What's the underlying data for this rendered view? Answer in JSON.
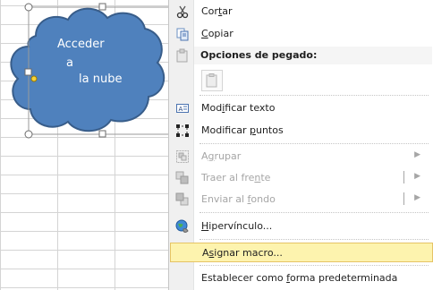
{
  "shape": {
    "line1": "Acceder",
    "line2": "a",
    "line3": "la nube"
  },
  "menu": {
    "cortar": {
      "pre": "Cor",
      "key": "t",
      "post": "ar"
    },
    "copiar": {
      "pre": "",
      "key": "C",
      "post": "opiar"
    },
    "paste_header": "Opciones de pegado:",
    "modificar_texto": {
      "pre": "Mod",
      "key": "i",
      "post": "ficar texto"
    },
    "modificar_puntos": {
      "pre": "Modificar ",
      "key": "p",
      "post": "untos"
    },
    "agrupar": {
      "pre": "A",
      "key": "g",
      "post": "rupar"
    },
    "traer": {
      "pre": "Traer al fre",
      "key": "n",
      "post": "te"
    },
    "enviar": {
      "pre": "Enviar al ",
      "key": "f",
      "post": "ondo"
    },
    "hipervinculo": {
      "pre": "",
      "key": "H",
      "post": "ipervínculo..."
    },
    "asignar": {
      "pre": "A",
      "key": "s",
      "post": "ignar macro..."
    },
    "establecer": {
      "pre": "Establecer como ",
      "key": "f",
      "post": "orma predeterminada"
    }
  },
  "colors": {
    "cloud_fill": "#4f81bd",
    "cloud_stroke": "#385d8a",
    "highlight": "#fdf3ae"
  }
}
